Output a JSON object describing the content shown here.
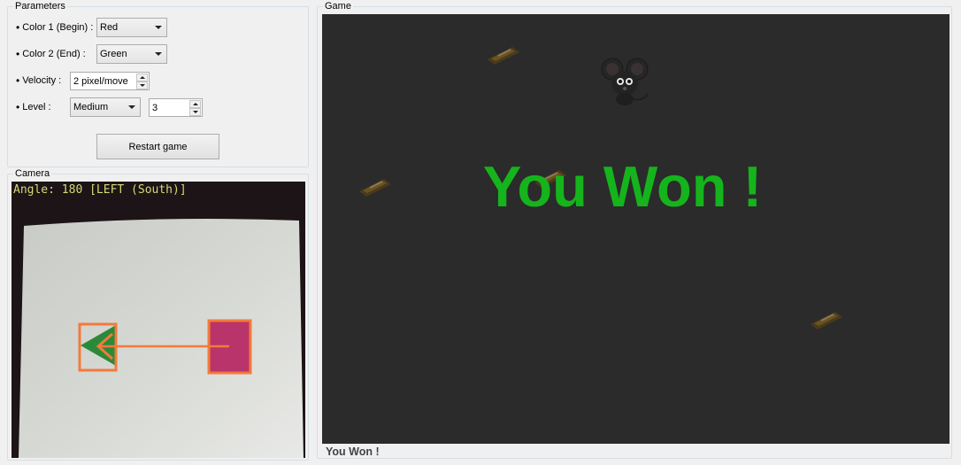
{
  "parameters": {
    "title": "Parameters",
    "color1_label": "Color 1 (Begin) :",
    "color1_value": "Red",
    "color2_label": "Color 2 (End) :",
    "color2_value": "Green",
    "velocity_label": "Velocity :",
    "velocity_value": "2  pixel/move",
    "level_label": "Level :",
    "level_value": "Medium",
    "level_number": "3",
    "restart_label": "Restart game"
  },
  "camera": {
    "title": "Camera",
    "angle_text": "Angle: 180 [LEFT (South)]"
  },
  "game": {
    "title": "Game",
    "message": "You Won !",
    "status": "You Won !"
  },
  "colors": {
    "win_green": "#15b41c",
    "board_bg": "#2b2b2b",
    "marker_orange": "#f47a3a",
    "begin_marker": "#b8346a",
    "end_marker": "#2b8a3a"
  }
}
